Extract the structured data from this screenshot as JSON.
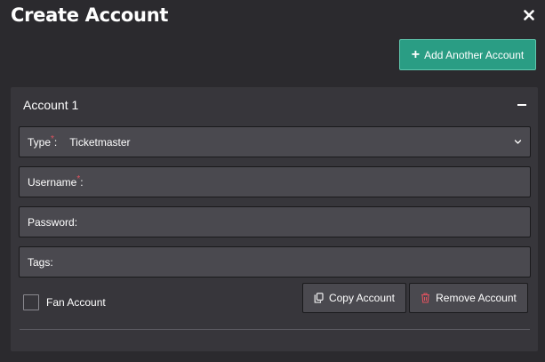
{
  "modal": {
    "title": "Create Account",
    "close_icon": "close-icon"
  },
  "toolbar": {
    "add_label": "Add Another Account",
    "add_icon": "plus-icon"
  },
  "account": {
    "title": "Account 1",
    "collapse_icon": "minus-icon",
    "type": {
      "label": "Type",
      "required_mark": "*",
      "colon": ":",
      "value": "Ticketmaster",
      "icon": "chevron-down-icon"
    },
    "username": {
      "label": "Username",
      "required_mark": "*",
      "colon": ":",
      "value": ""
    },
    "password": {
      "label": "Password:",
      "value": ""
    },
    "tags": {
      "label": "Tags:",
      "value": ""
    },
    "fan_account": {
      "label": "Fan Account",
      "checked": false
    },
    "copy_button": {
      "label": "Copy Account",
      "icon": "copy-icon"
    },
    "remove_button": {
      "label": "Remove Account",
      "icon": "trash-icon"
    }
  },
  "colors": {
    "background": "#2b2a2e",
    "panel": "#37363b",
    "field": "#4a494f",
    "accent": "#2a9d84",
    "required": "#e0525f",
    "trash": "#e0525f"
  }
}
